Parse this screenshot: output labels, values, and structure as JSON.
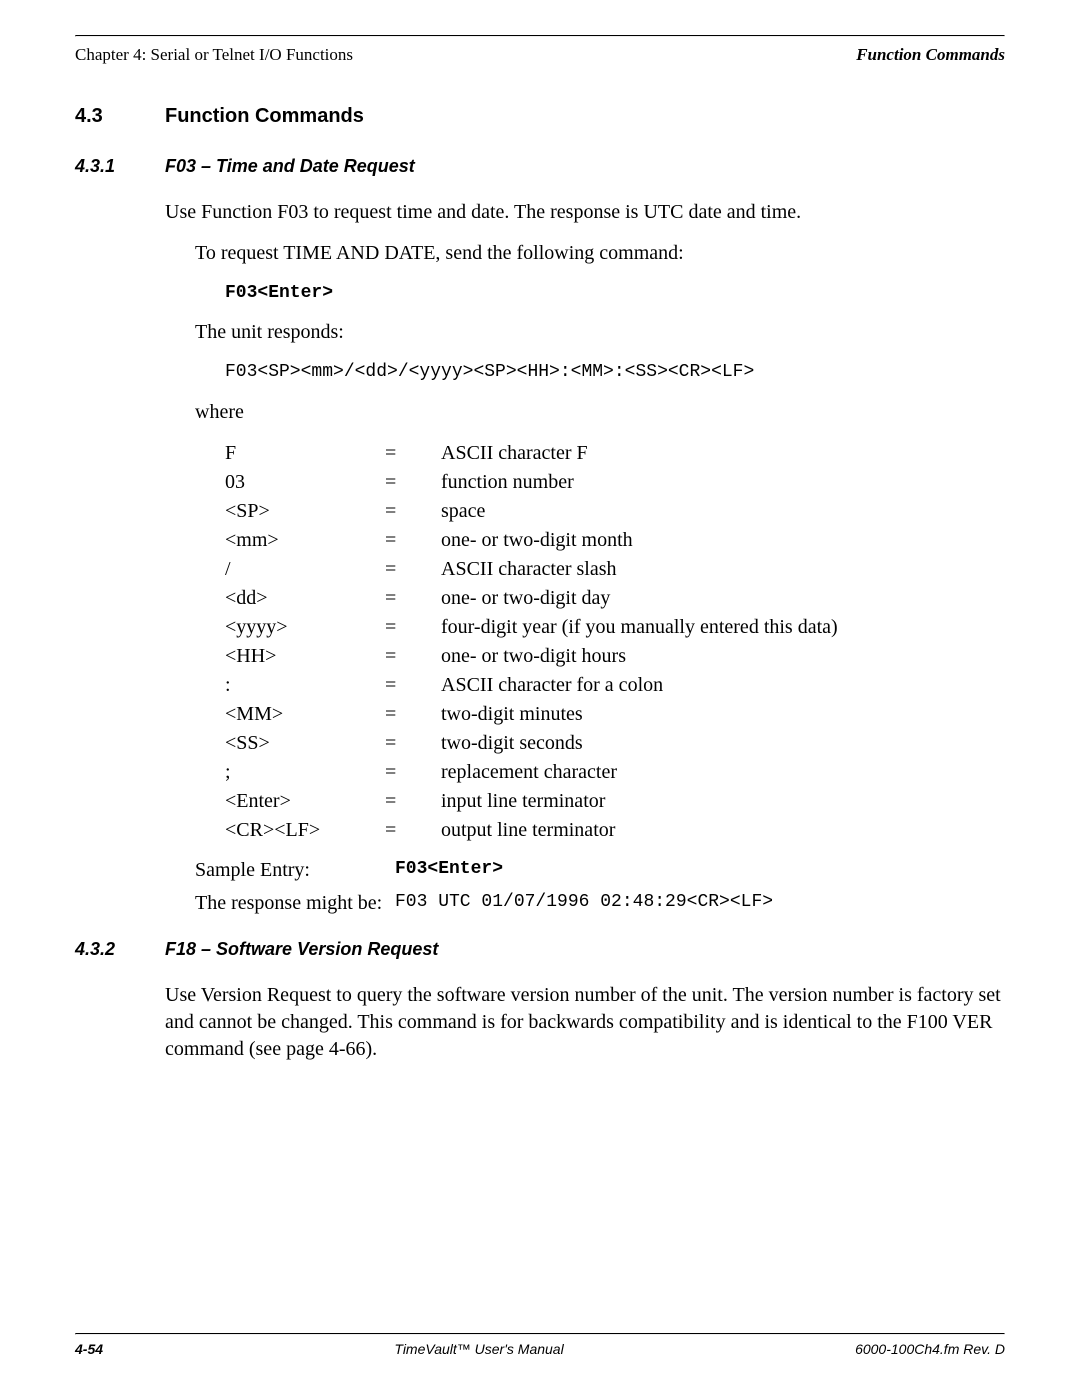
{
  "header": {
    "left": "Chapter 4: Serial or Telnet I/O Functions",
    "right": "Function Commands"
  },
  "section": {
    "num": "4.3",
    "title": "Function Commands"
  },
  "sub1": {
    "num": "4.3.1",
    "title": "F03 – Time and Date Request",
    "p1": "Use Function F03 to request time and date.  The response is UTC date and time.",
    "p2": "To request TIME AND DATE, send the following command:",
    "cmd": "F03<Enter>",
    "p3": "The unit responds:",
    "resp": "F03<SP><mm>/<dd>/<yyyy><SP><HH>:<MM>:<SS><CR><LF>",
    "where": "where",
    "defs": [
      {
        "sym": "F",
        "desc": "ASCII character F"
      },
      {
        "sym": "03",
        "desc": "function number"
      },
      {
        "sym": "<SP>",
        "desc": "space"
      },
      {
        "sym": "<mm>",
        "desc": "one- or two-digit month"
      },
      {
        "sym": "/",
        "desc": "ASCII character slash"
      },
      {
        "sym": "<dd>",
        "desc": "one- or two-digit day"
      },
      {
        "sym": "<yyyy>",
        "desc": "four-digit year (if you manually entered this data)"
      },
      {
        "sym": "<HH>",
        "desc": "one- or two-digit hours"
      },
      {
        "sym": ":",
        "desc": "ASCII character for a colon"
      },
      {
        "sym": "<MM>",
        "desc": "two-digit minutes"
      },
      {
        "sym": "<SS>",
        "desc": "two-digit seconds"
      },
      {
        "sym": ";",
        "desc": "replacement character"
      },
      {
        "sym": "<Enter>",
        "desc": "input line terminator"
      },
      {
        "sym": "<CR><LF>",
        "desc": "output line terminator"
      }
    ],
    "sampleLabel": "Sample Entry:",
    "sampleVal": "F03<Enter>",
    "responseLabel": "The response might be:",
    "responseVal": "F03 UTC 01/07/1996 02:48:29<CR><LF>"
  },
  "sub2": {
    "num": "4.3.2",
    "title": "F18 – Software Version Request",
    "p1": "Use Version Request to query the software version number of the unit.  The version number is factory set and cannot be changed.  This command is for backwards compatibility and is identical to the F100 VER command (see  page 4-66)."
  },
  "footer": {
    "left": "4-54",
    "center": "TimeVault™ User's Manual",
    "right": "6000-100Ch4.fm  Rev. D"
  },
  "eq": "="
}
